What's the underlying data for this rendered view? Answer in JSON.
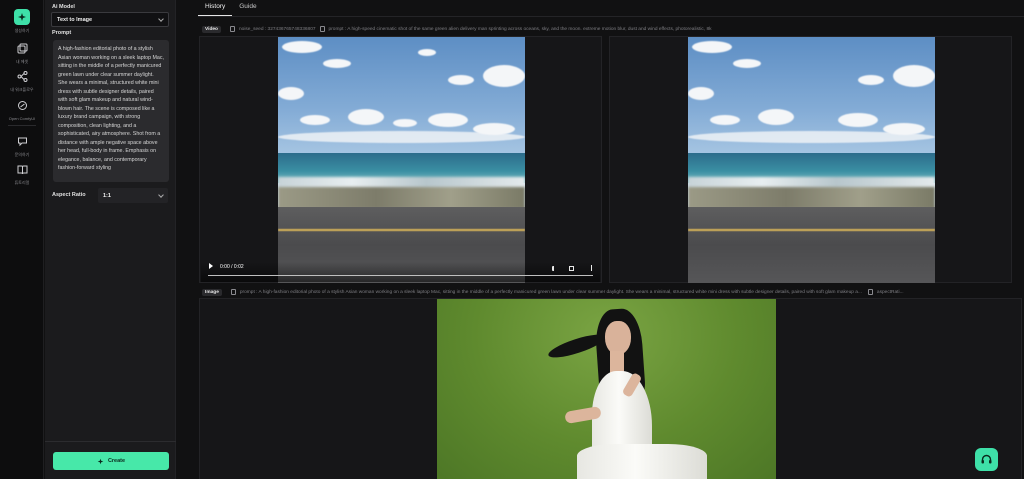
{
  "rail": {
    "items": [
      {
        "label": "생성하기",
        "icon": "sparkle-icon",
        "active": true
      },
      {
        "label": "내 에셋",
        "icon": "gallery-icon"
      },
      {
        "label": "내 워크플로우",
        "icon": "workflow-icon"
      },
      {
        "label": "Open ComfyUI",
        "icon": "comfyui-icon"
      },
      {
        "label": "문의하기",
        "icon": "chat-icon"
      },
      {
        "label": "튜토리얼",
        "icon": "book-icon"
      }
    ]
  },
  "panel": {
    "ai_model_label": "Ai Model",
    "ai_model_value": "Text to Image",
    "prompt_label": "Prompt",
    "prompt_text": "A high-fashion editorial photo of a stylish Asian woman working on a sleek laptop Mac, sitting in the middle of a perfectly manicured green lawn under clear summer daylight. She wears a minimal, structured white mini dress with subtle designer details, paired with soft glam makeup and natural wind-blown hair. The scene is composed like a luxury brand campaign, with strong composition, clean lighting, and a sophisticated, airy atmosphere. Shot from a distance with ample negative space above her head, full-body in frame. Emphasis on elegance, balance, and contemporary fashion-forward styling",
    "aspect_label": "Aspect Ratio",
    "aspect_value": "1:1",
    "create_label": "Create"
  },
  "tabs": [
    {
      "label": "History",
      "active": true
    },
    {
      "label": "Guide",
      "active": false
    }
  ],
  "video_row": {
    "chip": "Video",
    "seed": "noise_seed : 327436765748336807",
    "prompt": "prompt : A high-speed cinematic shot of the same green alien delivery man sprinting across oceans, sky, and the moon. extreme motion blur, dust and wind effects, photorealistic, 8k",
    "time": "0:00 / 0:02"
  },
  "image_row": {
    "chip": "Image",
    "prompt": "prompt : A high-fashion editorial photo of a stylish Asian woman working on a sleek laptop Mac, sitting in the middle of a perfectly manicured green lawn under clear summer daylight. She wears a minimal, structured white mini dress with subtle designer details, paired with soft glam makeup a...",
    "extra": "aspectRati..."
  },
  "colors": {
    "accent": "#3ee0a8",
    "bg": "#111112",
    "panel": "#1b1b1d"
  }
}
